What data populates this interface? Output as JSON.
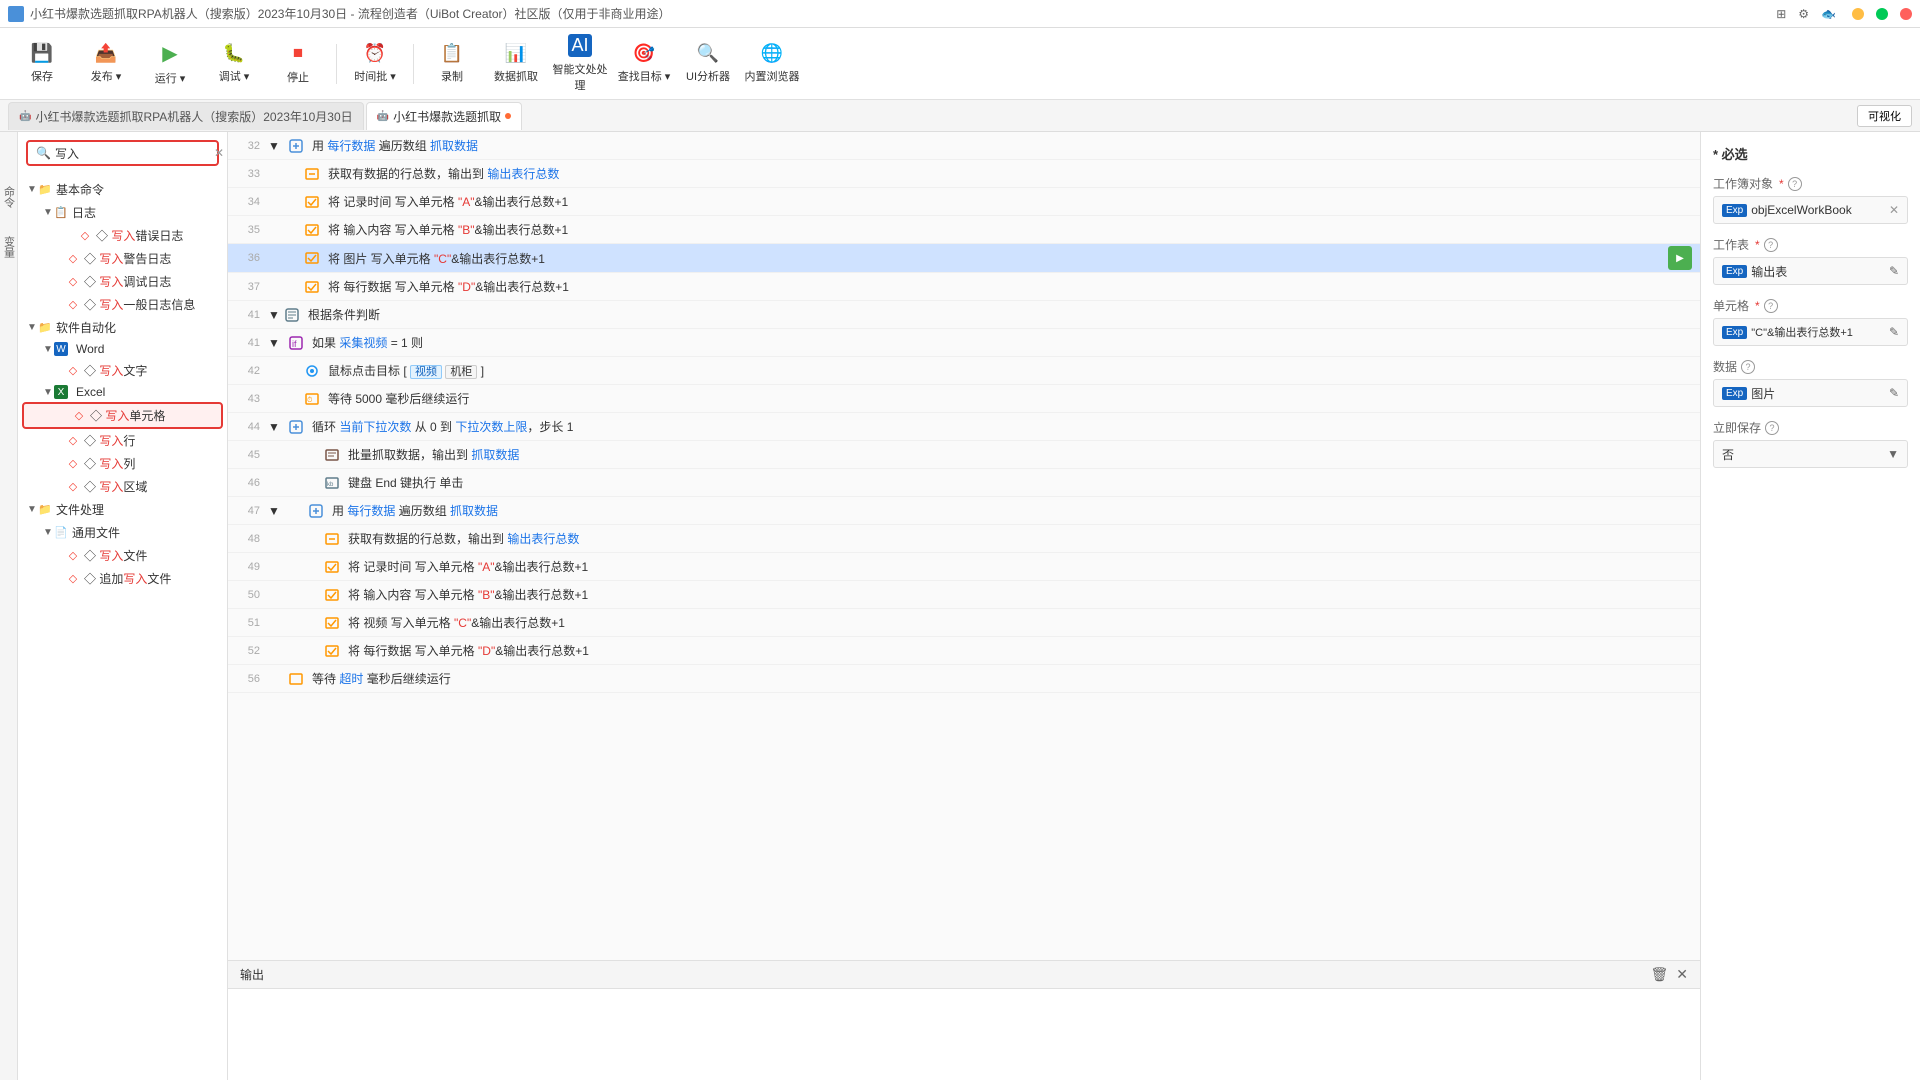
{
  "titleBar": {
    "icon": "🤖",
    "text": "小红书爆款选题抓取RPA机器人（搜索版）2023年10月30日 - 流程创造者（UiBot Creator）社区版（仅用于非商业用途）",
    "minBtn": "—",
    "maxBtn": "□",
    "closeBtn": "✕"
  },
  "toolbar": {
    "buttons": [
      {
        "id": "save",
        "icon": "💾",
        "label": "保存"
      },
      {
        "id": "publish",
        "icon": "📤",
        "label": "发布 ▾"
      },
      {
        "id": "run",
        "icon": "▶",
        "label": "运行 ▾"
      },
      {
        "id": "debug",
        "icon": "🐛",
        "label": "调试 ▾"
      },
      {
        "id": "stop",
        "icon": "⏹",
        "label": "停止"
      },
      {
        "id": "timer",
        "icon": "⏰",
        "label": "时间批 ▾"
      },
      {
        "id": "copy",
        "icon": "📋",
        "label": "录制"
      },
      {
        "id": "data-capture",
        "icon": "📊",
        "label": "数据抓取"
      },
      {
        "id": "ai-process",
        "icon": "🤖",
        "label": "智能文处处理"
      },
      {
        "id": "find-target",
        "icon": "🎯",
        "label": "查找目标 ▾"
      },
      {
        "id": "ui-analyzer",
        "icon": "🔍",
        "label": "UI分析器"
      },
      {
        "id": "browser",
        "icon": "🌐",
        "label": "内置浏览器"
      }
    ]
  },
  "tabs": [
    {
      "id": "main-tab",
      "label": "小红书爆款选题抓取RPA机器人（搜索版）2023年10月30日",
      "active": false,
      "icon": "🤖"
    },
    {
      "id": "capture-tab",
      "label": "小红书爆款选题抓取",
      "active": true,
      "icon": "🤖",
      "dot": true
    }
  ],
  "visibility_btn": "可视化",
  "search": {
    "placeholder": "写入",
    "value": "写入",
    "clear_btn": "✕"
  },
  "sidebar": {
    "sections": [
      {
        "id": "basic-commands",
        "label": "基本命令",
        "expanded": true,
        "children": [
          {
            "id": "log",
            "label": "日志",
            "icon": "📋",
            "expanded": true,
            "children": [
              {
                "id": "write-error-log",
                "label": "写入错误日志",
                "highlight": "写入",
                "type": "write"
              },
              {
                "id": "write-warn-log",
                "label": "写入警告日志",
                "highlight": "写入",
                "type": "write"
              },
              {
                "id": "write-debug-log",
                "label": "写入调试日志",
                "highlight": "写入",
                "type": "write"
              },
              {
                "id": "write-general-log",
                "label": "写入一般日志信息",
                "highlight": "写入",
                "type": "write"
              }
            ]
          }
        ]
      },
      {
        "id": "software-automation",
        "label": "软件自动化",
        "expanded": true,
        "children": [
          {
            "id": "word",
            "label": "Word",
            "icon": "W",
            "expanded": true,
            "children": [
              {
                "id": "write-text",
                "label": "写入文字",
                "highlight": "写入",
                "type": "write"
              }
            ]
          },
          {
            "id": "excel",
            "label": "Excel",
            "icon": "X",
            "expanded": true,
            "children": [
              {
                "id": "write-cell",
                "label": "写入单元格",
                "highlight": "写入",
                "type": "write",
                "selected": true
              },
              {
                "id": "write-row",
                "label": "写入行",
                "highlight": "写入",
                "type": "write"
              },
              {
                "id": "write-column",
                "label": "写入列",
                "highlight": "写入",
                "type": "write"
              },
              {
                "id": "write-range",
                "label": "写入区域",
                "highlight": "写入",
                "type": "write"
              }
            ]
          }
        ]
      },
      {
        "id": "file-processing",
        "label": "文件处理",
        "expanded": true,
        "children": [
          {
            "id": "general-file",
            "label": "通用文件",
            "icon": "📄",
            "expanded": true,
            "children": [
              {
                "id": "write-file",
                "label": "写入文件",
                "highlight": "写入",
                "type": "write"
              },
              {
                "id": "append-write-file",
                "label": "追加写入文件",
                "highlight": "写入",
                "type": "write"
              }
            ]
          }
        ]
      }
    ]
  },
  "flowRows": [
    {
      "num": "32",
      "indent": 1,
      "type": "loop",
      "content": "用 每行数据 遍历数组 抓取数据",
      "links": [
        "每行数据",
        "抓取数据"
      ]
    },
    {
      "num": "33",
      "indent": 2,
      "type": "capture",
      "content": "获取有数据的行总数，输出到 输出表行总数",
      "links": [
        "输出表行总数"
      ]
    },
    {
      "num": "34",
      "indent": 2,
      "type": "write",
      "content": "将 记录时间 写入单元格 \"A\"&输出表行总数+1",
      "links": [],
      "strings": [
        "\"A\""
      ]
    },
    {
      "num": "35",
      "indent": 2,
      "type": "write",
      "content": "将 输入内容 写入单元格 \"B\"&输出表行总数+1",
      "links": [],
      "strings": [
        "\"B\""
      ]
    },
    {
      "num": "36",
      "indent": 2,
      "type": "write",
      "content": "将 图片 写入单元格 \"C\"&输出表行总数+1",
      "links": [],
      "strings": [
        "\"C\""
      ],
      "highlighted": true,
      "hasPlayBtn": true
    },
    {
      "num": "37",
      "indent": 2,
      "type": "write",
      "content": "将 每行数据 写入单元格 \"D\"&输出表行总数+1",
      "links": [],
      "strings": [
        "\"D\""
      ]
    },
    {
      "num": "41",
      "indent": 0,
      "type": "condition-block",
      "content": "根据条件判断"
    },
    {
      "num": "41",
      "indent": 0,
      "type": "condition",
      "content": "如果 采集视频 = 1 则",
      "links": [
        "采集视频"
      ]
    },
    {
      "num": "42",
      "indent": 1,
      "type": "click",
      "content": "鼠标点击目标 [ 视频  机柜  ]",
      "tags": [
        "视频",
        "机柜"
      ]
    },
    {
      "num": "43",
      "indent": 1,
      "type": "wait",
      "content": "等待 5000 毫秒后继续运行"
    },
    {
      "num": "44",
      "indent": 1,
      "type": "loop",
      "content": "循环 当前下拉次数 从 0 到 下拉次数上限，步长 1",
      "links": [
        "当前下拉次数",
        "下拉次数上限"
      ]
    },
    {
      "num": "45",
      "indent": 2,
      "type": "batch",
      "content": "批量抓取数据，输出到 抓取数据",
      "links": [
        "抓取数据"
      ]
    },
    {
      "num": "46",
      "indent": 2,
      "type": "keyboard",
      "content": "键盘 End 键执行 单击"
    },
    {
      "num": "47",
      "indent": 1,
      "type": "loop",
      "content": "用 每行数据 遍历数组 抓取数据",
      "links": [
        "每行数据",
        "抓取数据"
      ]
    },
    {
      "num": "48",
      "indent": 2,
      "type": "capture",
      "content": "获取有数据的行总数，输出到 输出表行总数",
      "links": [
        "输出表行总数"
      ]
    },
    {
      "num": "49",
      "indent": 2,
      "type": "write",
      "content": "将 记录时间 写入单元格 \"A\"&输出表行总数+1",
      "strings": [
        "\"A\""
      ]
    },
    {
      "num": "50",
      "indent": 2,
      "type": "write",
      "content": "将 输入内容 写入单元格 \"B\"&输出表行总数+1",
      "strings": [
        "\"B\""
      ]
    },
    {
      "num": "51",
      "indent": 2,
      "type": "write",
      "content": "将 视频 写入单元格 \"C\"&输出表行总数+1",
      "strings": [
        "\"C\""
      ]
    },
    {
      "num": "52",
      "indent": 2,
      "type": "write",
      "content": "将 每行数据 写入单元格 \"D\"&输出表行总数+1",
      "strings": [
        "\"D\""
      ]
    },
    {
      "num": "56",
      "indent": 0,
      "type": "wait",
      "content": "等待 超时 毫秒后继续运行",
      "links": [
        "超时"
      ]
    }
  ],
  "rightPanel": {
    "title": "* 必选",
    "sections": [
      {
        "id": "work-object",
        "label": "工作簿对象",
        "helpIcon": "?",
        "value": "objExcelWorkBook",
        "expBadge": "Exp",
        "hasClose": true
      },
      {
        "id": "work-table",
        "label": "工作表",
        "helpIcon": "?",
        "value": "输出表",
        "expBadge": "Exp",
        "hasEdit": true
      },
      {
        "id": "cell",
        "label": "单元格",
        "helpIcon": "?",
        "value": "\"C\"&输出表行总数+1",
        "expBadge": "Exp",
        "hasEdit": true
      },
      {
        "id": "data",
        "label": "数据",
        "helpIcon": "?",
        "value": "图片",
        "expBadge": "Exp",
        "hasEdit": true
      },
      {
        "id": "immediate-save",
        "label": "立即保存",
        "helpIcon": "?",
        "value": "否",
        "hasDropdown": true
      }
    ]
  },
  "outputPanel": {
    "title": "输出",
    "clearBtn": "🗑",
    "closeBtn": "✕"
  }
}
